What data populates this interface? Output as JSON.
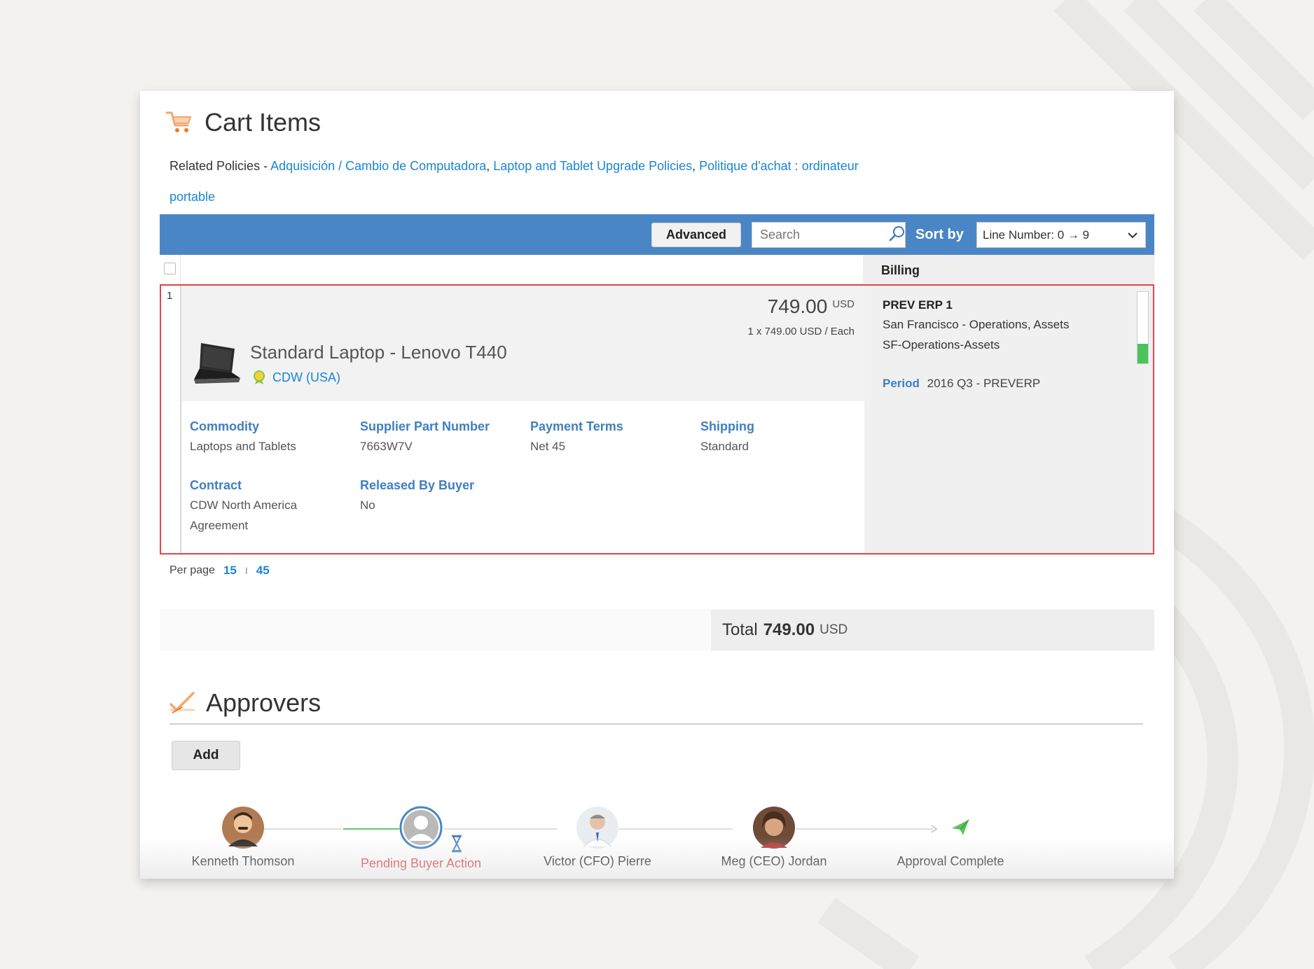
{
  "cart": {
    "title": "Cart Items",
    "related_label": "Related Policies - ",
    "policies": [
      "Adquisición / Cambio de Computadora",
      "Laptop and Tablet Upgrade Policies",
      "Politique d'achat : ordinateur portable"
    ],
    "policy_sep": ", "
  },
  "toolbar": {
    "advanced_label": "Advanced",
    "search_placeholder": "Search",
    "sort_label": "Sort by",
    "sort_value": "Line Number: 0 → 9"
  },
  "table": {
    "billing_header": "Billing"
  },
  "item": {
    "line_number": "1",
    "name": "Standard Laptop - Lenovo T440",
    "supplier": "CDW (USA)",
    "price": "749.00",
    "currency": "USD",
    "unit_price": "1 x 749.00 USD / Each",
    "fields": {
      "commodity_label": "Commodity",
      "commodity_value": "Laptops and Tablets",
      "part_label": "Supplier Part Number",
      "part_value": "7663W7V",
      "terms_label": "Payment Terms",
      "terms_value": "Net 45",
      "shipping_label": "Shipping",
      "shipping_value": "Standard",
      "contract_label": "Contract",
      "contract_value": "CDW North America Agreement",
      "released_label": "Released By Buyer",
      "released_value": "No"
    },
    "billing": {
      "title": "PREV ERP 1",
      "line1": "San Francisco - Operations, Assets",
      "line2": "SF-Operations-Assets",
      "period_label": "Period",
      "period_value": "2016 Q3 - PREVERP"
    }
  },
  "pagination": {
    "per_page_label": "Per page",
    "options": [
      "15",
      "45"
    ],
    "separator": "I"
  },
  "total": {
    "label": "Total",
    "amount": "749.00",
    "currency": "USD"
  },
  "approvers": {
    "title": "Approvers",
    "add_label": "Add",
    "steps": [
      {
        "name": "Kenneth Thomson",
        "status": "approved"
      },
      {
        "name": "Pending Buyer Action",
        "status": "pending"
      },
      {
        "name": "Victor (CFO) Pierre",
        "status": "waiting"
      },
      {
        "name": "Meg (CEO) Jordan",
        "status": "waiting"
      },
      {
        "name": "Approval Complete",
        "status": "final"
      }
    ]
  },
  "colors": {
    "accent_blue": "#4a86c5",
    "link_blue": "#1a85d6",
    "highlight_red": "#e0474c",
    "pending_red": "#e0393e",
    "success_green": "#4cc35a"
  }
}
